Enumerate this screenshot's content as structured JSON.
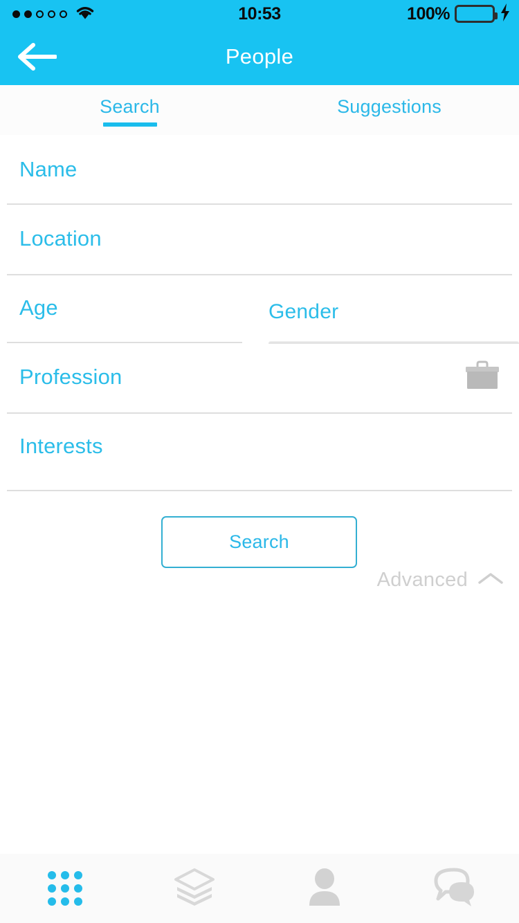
{
  "statusbar": {
    "signal_dots_filled": 2,
    "signal_dots_total": 5,
    "wifi_icon": "wifi-icon",
    "time": "10:53",
    "battery_percent": "100%",
    "battery_icon": "battery-full-icon",
    "charging_icon": "lightning-bolt-icon"
  },
  "header": {
    "back_icon": "arrow-left-icon",
    "title": "People",
    "background_color": "#18C3F2"
  },
  "tabs": {
    "items": [
      {
        "label": "Search",
        "active": true
      },
      {
        "label": "Suggestions",
        "active": false
      }
    ],
    "active_color": "#19BDED"
  },
  "form": {
    "fields": [
      {
        "name": "name",
        "label": "Name",
        "value": "",
        "placeholder": "Name"
      },
      {
        "name": "location",
        "label": "Location",
        "value": "",
        "placeholder": "Location"
      },
      {
        "name": "age",
        "label": "Age",
        "value": "",
        "placeholder": "Age"
      },
      {
        "name": "gender",
        "label": "Gender",
        "value": "",
        "placeholder": "Gender"
      },
      {
        "name": "profession",
        "label": "Profession",
        "value": "",
        "placeholder": "Profession",
        "icon": "briefcase-icon"
      },
      {
        "name": "interests",
        "label": "Interests",
        "value": "",
        "placeholder": "Interests"
      }
    ],
    "label_color": "#2BBDE9",
    "divider_color": "#DEDEDE"
  },
  "actions": {
    "search_label": "Search",
    "search_border_color": "#33AFD2",
    "advanced_label": "Advanced",
    "advanced_icon": "chevron-up-icon",
    "advanced_color": "#CFCFCF"
  },
  "bottom_nav": {
    "items": [
      {
        "name": "grid",
        "icon": "grid-icon",
        "active": true
      },
      {
        "name": "layers",
        "icon": "layers-icon",
        "active": false
      },
      {
        "name": "profile",
        "icon": "person-icon",
        "active": false
      },
      {
        "name": "messages",
        "icon": "chat-bubbles-icon",
        "active": false
      }
    ],
    "active_color": "#25BCEA",
    "inactive_color": "#D6D6D6"
  }
}
